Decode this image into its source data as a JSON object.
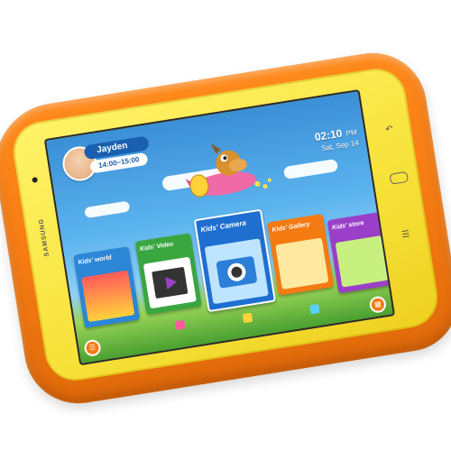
{
  "device": {
    "brand": "SAMSUNG"
  },
  "profile": {
    "name": "Jayden",
    "time_range": "14:00~15:00"
  },
  "status": {
    "time": "02:10",
    "ampm": "PM",
    "date": "Sat, Sep 14"
  },
  "apps": [
    {
      "label": "Kids' world",
      "color": "#2d86d6"
    },
    {
      "label": "Kids' Video",
      "color": "#3aa640"
    },
    {
      "label": "Kids' Camera",
      "color": "#1f6fd0"
    },
    {
      "label": "Kids' Gallery",
      "color": "#f47a12"
    },
    {
      "label": "Kids' store",
      "color": "#9b3fc8"
    }
  ],
  "icons": {
    "menu": "list-icon",
    "apps": "apps-grid-icon",
    "back": "back-arrow-icon",
    "home": "home-button-icon",
    "recent": "menu-icon"
  },
  "colors": {
    "bumper": "#f47a12",
    "bezel": "#f7e23a",
    "sky": "#5cb4ee",
    "grass": "#4aa030"
  }
}
